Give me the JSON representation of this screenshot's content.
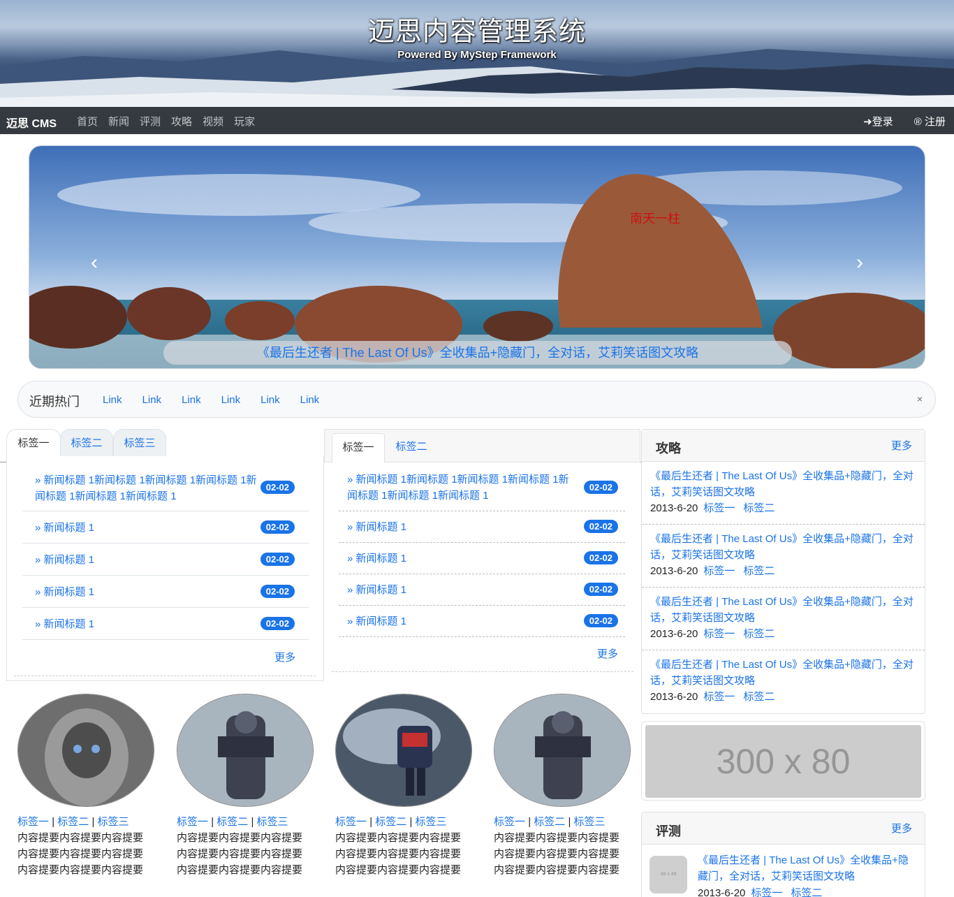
{
  "header": {
    "title": "迈思内容管理系统",
    "subtitle": "Powered By MyStep Framework"
  },
  "navbar": {
    "brand": "迈思 CMS",
    "items": [
      "首页",
      "新闻",
      "评测",
      "攻略",
      "视频",
      "玩家"
    ],
    "login": "登录",
    "register": "注册"
  },
  "carousel": {
    "caption": "《最后生还者 | The Last Of Us》全收集品+隐藏门，全对话，艾莉笑话图文攻略",
    "prev": "‹",
    "next": "›"
  },
  "hot": {
    "title": "近期热门",
    "links": [
      "Link",
      "Link",
      "Link",
      "Link",
      "Link",
      "Link"
    ],
    "close": "×"
  },
  "panel1": {
    "tabs": [
      "标签一",
      "标签二",
      "标签三"
    ],
    "items": [
      {
        "title": "» 新闻标题 1新闻标题 1新闻标题 1新闻标题 1新闻标题 1新闻标题 1新闻标题 1",
        "date": "02-02"
      },
      {
        "title": "» 新闻标题 1",
        "date": "02-02"
      },
      {
        "title": "» 新闻标题 1",
        "date": "02-02"
      },
      {
        "title": "» 新闻标题 1",
        "date": "02-02"
      },
      {
        "title": "» 新闻标题 1",
        "date": "02-02"
      }
    ],
    "more": "更多"
  },
  "panel2": {
    "tabs": [
      "标签一",
      "标签二"
    ],
    "items": [
      {
        "title": "» 新闻标题 1新闻标题 1新闻标题 1新闻标题 1新闻标题 1新闻标题 1新闻标题 1",
        "date": "02-02"
      },
      {
        "title": "» 新闻标题 1",
        "date": "02-02"
      },
      {
        "title": "» 新闻标题 1",
        "date": "02-02"
      },
      {
        "title": "» 新闻标题 1",
        "date": "02-02"
      },
      {
        "title": "» 新闻标题 1",
        "date": "02-02"
      }
    ],
    "more": "更多"
  },
  "guide": {
    "title": "攻略",
    "more": "更多",
    "items": [
      {
        "title": "《最后生还者 | The Last Of Us》全收集品+隐藏门，全对话，艾莉笑话图文攻略",
        "date": "2013-6-20",
        "tag1": "标签一",
        "tag2": "标签二"
      },
      {
        "title": "《最后生还者 | The Last Of Us》全收集品+隐藏门，全对话，艾莉笑话图文攻略",
        "date": "2013-6-20",
        "tag1": "标签一",
        "tag2": "标签二"
      },
      {
        "title": "《最后生还者 | The Last Of Us》全收集品+隐藏门，全对话，艾莉笑话图文攻略",
        "date": "2013-6-20",
        "tag1": "标签一",
        "tag2": "标签二"
      },
      {
        "title": "《最后生还者 | The Last Of Us》全收集品+隐藏门，全对话，艾莉笑话图文攻略",
        "date": "2013-6-20",
        "tag1": "标签一",
        "tag2": "标签二"
      }
    ]
  },
  "ad": {
    "text": "300 x 80"
  },
  "review": {
    "title": "评测",
    "more": "更多",
    "thumb": "48 x 48",
    "item": {
      "title": "《最后生还者 | The Last Of Us》全收集品+隐藏门，全对话，艾莉笑话图文攻略",
      "date": "2013-6-20",
      "tag1": "标签一",
      "tag2": "标签二"
    }
  },
  "gallery": [
    {
      "tag1": "标签一",
      "tag2": "标签二",
      "tag3": "标签三",
      "summary": "内容提要内容提要内容提要内容提要内容提要内容提要内容提要内容提要内容提要"
    },
    {
      "tag1": "标签一",
      "tag2": "标签二",
      "tag3": "标签三",
      "summary": "内容提要内容提要内容提要内容提要内容提要内容提要内容提要内容提要内容提要"
    },
    {
      "tag1": "标签一",
      "tag2": "标签二",
      "tag3": "标签三",
      "summary": "内容提要内容提要内容提要内容提要内容提要内容提要内容提要内容提要内容提要"
    },
    {
      "tag1": "标签一",
      "tag2": "标签二",
      "tag3": "标签三",
      "summary": "内容提要内容提要内容提要内容提要内容提要内容提要内容提要内容提要内容提要"
    }
  ],
  "separator": "|",
  "icons": {
    "login": "sign-in-icon",
    "register": "registered-icon"
  }
}
